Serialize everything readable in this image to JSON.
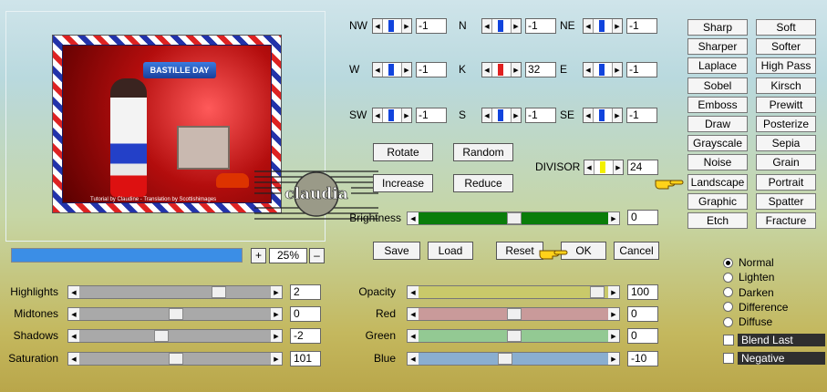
{
  "preview": {
    "art_title": "BASTILLE DAY",
    "art_credit": "Tutorial by Claudine - Translation by Scottishimages",
    "watermark_text": "claudia"
  },
  "progress": {
    "fraction": 1.0
  },
  "zoom": {
    "plus": "+",
    "minus": "–",
    "value": "25%"
  },
  "matrix": [
    {
      "label": "NW",
      "value": "-1",
      "thumb": "#1144dd"
    },
    {
      "label": "N",
      "value": "-1",
      "thumb": "#1144dd"
    },
    {
      "label": "NE",
      "value": "-1",
      "thumb": "#1144dd"
    },
    {
      "label": "W",
      "value": "-1",
      "thumb": "#1144dd"
    },
    {
      "label": "K",
      "value": "32",
      "thumb": "#e02020"
    },
    {
      "label": "E",
      "value": "-1",
      "thumb": "#1144dd"
    },
    {
      "label": "SW",
      "value": "-1",
      "thumb": "#1144dd"
    },
    {
      "label": "S",
      "value": "-1",
      "thumb": "#1144dd"
    },
    {
      "label": "SE",
      "value": "-1",
      "thumb": "#1144dd"
    }
  ],
  "buttons": {
    "rotate": "Rotate",
    "random": "Random",
    "increase": "Increase",
    "reduce": "Reduce",
    "save": "Save",
    "load": "Load",
    "reset": "Reset",
    "ok": "OK",
    "cancel": "Cancel"
  },
  "divisor": {
    "label": "DIVISOR",
    "value": "24",
    "thumb": "#f3f000"
  },
  "brightness": {
    "label": "Brightness",
    "value": "0",
    "color": "#0a7d0a",
    "level": 0.5
  },
  "presets": [
    [
      "Sharp",
      "Soft"
    ],
    [
      "Sharper",
      "Softer"
    ],
    [
      "Laplace",
      "High Pass"
    ],
    [
      "Sobel",
      "Kirsch"
    ],
    [
      "Emboss",
      "Prewitt"
    ],
    [
      "Draw",
      "Posterize"
    ],
    [
      "Grayscale",
      "Sepia"
    ],
    [
      "Noise",
      "Grain"
    ],
    [
      "Landscape",
      "Portrait"
    ],
    [
      "Graphic",
      "Spatter"
    ],
    [
      "Etch",
      "Fracture"
    ]
  ],
  "left_sliders": [
    {
      "label": "Highlights",
      "value": "2",
      "level": 0.74
    },
    {
      "label": "Midtones",
      "value": "0",
      "level": 0.5
    },
    {
      "label": "Shadows",
      "value": "-2",
      "level": 0.42
    },
    {
      "label": "Saturation",
      "value": "101",
      "level": 0.5
    }
  ],
  "right_sliders": [
    {
      "label": "Opacity",
      "value": "100",
      "color": "#c9c96a",
      "level": 0.97
    },
    {
      "label": "Red",
      "value": "0",
      "color": "#c99a9a",
      "level": 0.5
    },
    {
      "label": "Green",
      "value": "0",
      "color": "#93c993",
      "level": 0.5
    },
    {
      "label": "Blue",
      "value": "-10",
      "color": "#8aaed0",
      "level": 0.45
    }
  ],
  "blend_modes": [
    {
      "label": "Normal",
      "selected": true
    },
    {
      "label": "Lighten",
      "selected": false
    },
    {
      "label": "Darken",
      "selected": false
    },
    {
      "label": "Difference",
      "selected": false
    },
    {
      "label": "Diffuse",
      "selected": false
    }
  ],
  "checks": {
    "blend_last": "Blend Last",
    "negative": "Negative"
  },
  "colors": {
    "slider_gray": "#a9a9a9",
    "progress": "#3b8ee6"
  }
}
